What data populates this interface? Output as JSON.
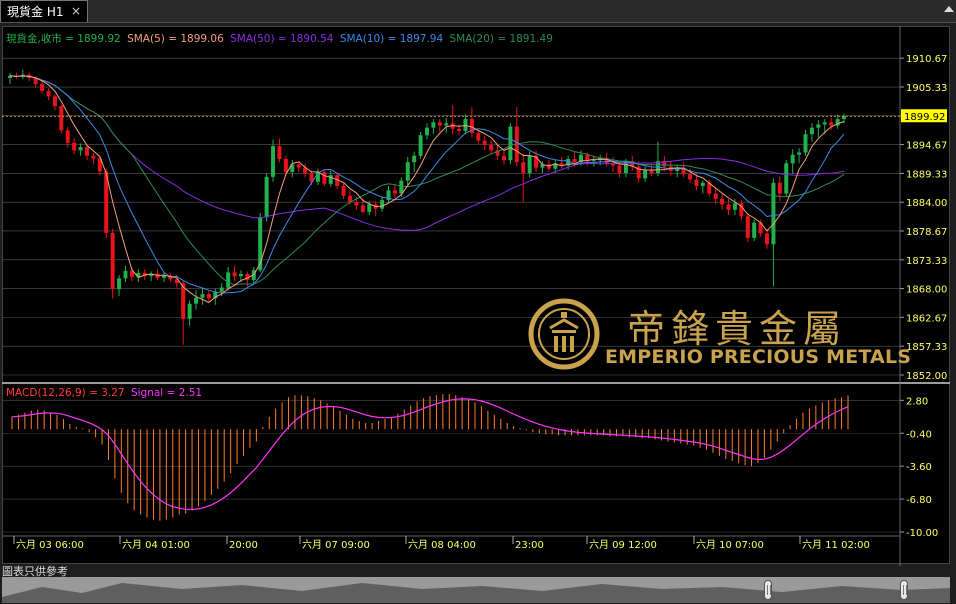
{
  "tab": {
    "title": "現貨金 H1",
    "close": "×"
  },
  "legend_main": {
    "symbol": "現貨金,收市 = 1899.92",
    "sma5": "SMA(5) = 1899.06",
    "sma50": "SMA(50) = 1890.54",
    "sma10": "SMA(10) = 1897.94",
    "sma20": "SMA(20) = 1891.49"
  },
  "legend_macd": {
    "macd": "MACD(12,26,9) = 3.27",
    "signal": "Signal = 2.51"
  },
  "current_price": "1899.92",
  "price_axis": [
    "1910.67",
    "1905.33",
    "1900.00",
    "1894.67",
    "1889.33",
    "1884.00",
    "1878.67",
    "1873.33",
    "1868.00",
    "1862.67",
    "1857.33",
    "1852.00"
  ],
  "macd_axis": [
    "2.80",
    "-0.40",
    "-3.60",
    "-6.80",
    "-10.00"
  ],
  "time_axis": [
    "六月 03 06:00",
    "六月 04 01:00",
    "20:00",
    "六月 07 09:00",
    "六月 08 04:00",
    "23:00",
    "六月 09 12:00",
    "六月 10 07:00",
    "六月 11 02:00"
  ],
  "logo": {
    "chinese": "帝鋒貴金屬",
    "english": "EMPERIO PRECIOUS METALS"
  },
  "footer_note": "圖表只供參考",
  "colors": {
    "bull": "#22b14c",
    "bear": "#e8141c",
    "sma5": "#f0a07a",
    "sma10": "#3d8ae8",
    "sma20": "#2e8b57",
    "sma50": "#8a2be2",
    "macd_hist": "#ff7f27",
    "signal": "#ff33ff",
    "axis_label": "#ffff66",
    "price_tag_bg": "#ffff00",
    "gold": "#c9a24e"
  },
  "chart_data": {
    "type": "candlestick",
    "price_range": [
      1852.0,
      1912.0
    ],
    "macd_range": [
      -10.0,
      4.0
    ],
    "candles": [
      [
        1907.0,
        1907.9,
        1905.9,
        1907.4
      ],
      [
        1907.4,
        1908.0,
        1906.9,
        1907.2
      ],
      [
        1907.2,
        1908.5,
        1906.8,
        1907.6
      ],
      [
        1907.6,
        1908.0,
        1906.4,
        1907.0
      ],
      [
        1907.0,
        1907.3,
        1905.2,
        1905.9
      ],
      [
        1905.9,
        1906.4,
        1904.1,
        1904.6
      ],
      [
        1904.6,
        1905.1,
        1902.9,
        1903.6
      ],
      [
        1903.6,
        1904.0,
        1901.0,
        1901.8
      ],
      [
        1901.8,
        1902.1,
        1896.7,
        1897.3
      ],
      [
        1897.3,
        1897.9,
        1894.1,
        1895.0
      ],
      [
        1895.0,
        1895.9,
        1892.9,
        1893.6
      ],
      [
        1893.6,
        1894.9,
        1892.6,
        1894.2
      ],
      [
        1894.2,
        1894.6,
        1891.8,
        1892.6
      ],
      [
        1892.6,
        1893.1,
        1891.0,
        1892.1
      ],
      [
        1892.1,
        1892.6,
        1889.0,
        1889.7
      ],
      [
        1889.7,
        1890.2,
        1877.4,
        1878.3
      ],
      [
        1878.3,
        1879.1,
        1866.2,
        1867.9
      ],
      [
        1867.9,
        1870.5,
        1866.6,
        1869.9
      ],
      [
        1869.9,
        1872.2,
        1869.2,
        1871.3
      ],
      [
        1871.3,
        1871.9,
        1869.4,
        1870.2
      ],
      [
        1870.2,
        1871.6,
        1869.2,
        1870.9
      ],
      [
        1870.9,
        1871.6,
        1869.6,
        1870.3
      ],
      [
        1870.3,
        1871.2,
        1869.4,
        1870.8
      ],
      [
        1870.8,
        1871.5,
        1869.6,
        1870.0
      ],
      [
        1870.0,
        1870.9,
        1869.2,
        1870.4
      ],
      [
        1870.4,
        1870.9,
        1869.2,
        1869.7
      ],
      [
        1869.7,
        1870.6,
        1868.2,
        1869.0
      ],
      [
        1869.0,
        1869.4,
        1857.6,
        1862.4
      ],
      [
        1862.4,
        1865.8,
        1861.1,
        1865.2
      ],
      [
        1865.2,
        1867.7,
        1864.1,
        1866.3
      ],
      [
        1866.3,
        1868.0,
        1865.0,
        1867.0
      ],
      [
        1867.0,
        1867.6,
        1865.6,
        1866.2
      ],
      [
        1866.2,
        1868.0,
        1865.0,
        1867.4
      ],
      [
        1867.4,
        1869.0,
        1866.6,
        1868.2
      ],
      [
        1868.2,
        1872.0,
        1867.6,
        1871.0
      ],
      [
        1871.0,
        1872.2,
        1869.4,
        1870.3
      ],
      [
        1870.3,
        1871.4,
        1869.2,
        1870.7
      ],
      [
        1870.7,
        1871.2,
        1868.4,
        1869.6
      ],
      [
        1869.6,
        1872.0,
        1869.0,
        1871.4
      ],
      [
        1871.4,
        1882.0,
        1871.0,
        1881.2
      ],
      [
        1881.2,
        1889.4,
        1880.4,
        1888.7
      ],
      [
        1888.7,
        1895.6,
        1887.8,
        1894.4
      ],
      [
        1894.4,
        1895.8,
        1891.4,
        1892.0
      ],
      [
        1892.0,
        1892.6,
        1888.8,
        1889.6
      ],
      [
        1889.6,
        1891.8,
        1888.6,
        1891.0
      ],
      [
        1891.0,
        1891.6,
        1889.6,
        1890.4
      ],
      [
        1890.4,
        1891.2,
        1888.6,
        1889.3
      ],
      [
        1889.3,
        1889.9,
        1887.2,
        1887.8
      ],
      [
        1887.8,
        1890.2,
        1887.2,
        1889.6
      ],
      [
        1889.6,
        1890.1,
        1887.0,
        1887.4
      ],
      [
        1887.4,
        1889.8,
        1886.8,
        1889.0
      ],
      [
        1889.0,
        1889.5,
        1886.4,
        1887.0
      ],
      [
        1887.0,
        1887.8,
        1884.6,
        1885.2
      ],
      [
        1885.2,
        1886.2,
        1883.6,
        1884.0
      ],
      [
        1884.0,
        1885.0,
        1882.6,
        1883.4
      ],
      [
        1883.4,
        1884.6,
        1881.8,
        1882.2
      ],
      [
        1882.2,
        1884.2,
        1881.6,
        1883.6
      ],
      [
        1883.6,
        1884.2,
        1881.4,
        1882.8
      ],
      [
        1882.8,
        1885.0,
        1882.2,
        1884.4
      ],
      [
        1884.4,
        1887.0,
        1883.8,
        1886.2
      ],
      [
        1886.2,
        1887.4,
        1884.8,
        1885.6
      ],
      [
        1885.6,
        1888.6,
        1885.0,
        1888.0
      ],
      [
        1888.0,
        1892.4,
        1887.2,
        1891.4
      ],
      [
        1891.4,
        1893.4,
        1889.6,
        1892.6
      ],
      [
        1892.6,
        1897.0,
        1892.0,
        1896.4
      ],
      [
        1896.4,
        1898.6,
        1895.6,
        1897.8
      ],
      [
        1897.8,
        1899.4,
        1896.6,
        1898.8
      ],
      [
        1898.8,
        1899.4,
        1897.0,
        1898.2
      ],
      [
        1898.2,
        1899.6,
        1896.8,
        1898.6
      ],
      [
        1898.6,
        1902.0,
        1896.6,
        1897.6
      ],
      [
        1897.6,
        1898.4,
        1896.4,
        1897.2
      ],
      [
        1897.2,
        1900.2,
        1896.6,
        1899.4
      ],
      [
        1899.4,
        1901.6,
        1896.0,
        1896.8
      ],
      [
        1896.8,
        1897.4,
        1894.8,
        1895.4
      ],
      [
        1895.4,
        1896.2,
        1893.6,
        1894.6
      ],
      [
        1894.6,
        1895.4,
        1893.0,
        1893.6
      ],
      [
        1893.6,
        1894.6,
        1891.8,
        1892.6
      ],
      [
        1892.6,
        1893.8,
        1891.0,
        1891.8
      ],
      [
        1891.8,
        1898.6,
        1891.0,
        1898.0
      ],
      [
        1898.0,
        1901.6,
        1890.6,
        1891.4
      ],
      [
        1891.4,
        1893.0,
        1884.0,
        1889.4
      ],
      [
        1889.4,
        1893.4,
        1888.6,
        1892.6
      ],
      [
        1892.6,
        1893.6,
        1889.6,
        1890.4
      ],
      [
        1890.4,
        1891.6,
        1889.4,
        1891.0
      ],
      [
        1891.0,
        1891.8,
        1889.6,
        1890.2
      ],
      [
        1890.2,
        1891.8,
        1889.4,
        1891.2
      ],
      [
        1891.2,
        1892.4,
        1890.2,
        1890.8
      ],
      [
        1890.8,
        1892.6,
        1890.0,
        1892.0
      ],
      [
        1892.0,
        1893.4,
        1890.6,
        1891.4
      ],
      [
        1891.4,
        1893.6,
        1890.8,
        1892.8
      ],
      [
        1892.8,
        1893.2,
        1890.8,
        1891.6
      ],
      [
        1891.6,
        1892.6,
        1890.6,
        1891.8
      ],
      [
        1891.8,
        1892.8,
        1890.8,
        1892.2
      ],
      [
        1892.2,
        1893.2,
        1890.6,
        1891.2
      ],
      [
        1891.2,
        1892.4,
        1889.6,
        1890.8
      ],
      [
        1890.8,
        1891.6,
        1888.6,
        1889.4
      ],
      [
        1889.4,
        1892.0,
        1888.6,
        1891.4
      ],
      [
        1891.4,
        1892.6,
        1889.8,
        1890.6
      ],
      [
        1890.6,
        1891.6,
        1887.6,
        1888.4
      ],
      [
        1888.4,
        1890.6,
        1887.8,
        1890.0
      ],
      [
        1890.0,
        1891.0,
        1888.8,
        1889.4
      ],
      [
        1889.4,
        1895.2,
        1888.8,
        1891.6
      ],
      [
        1891.6,
        1892.6,
        1889.8,
        1890.6
      ],
      [
        1890.6,
        1891.6,
        1888.8,
        1889.8
      ],
      [
        1889.8,
        1890.8,
        1888.6,
        1890.4
      ],
      [
        1890.4,
        1891.4,
        1888.6,
        1889.2
      ],
      [
        1889.2,
        1890.2,
        1887.6,
        1888.2
      ],
      [
        1888.2,
        1889.2,
        1886.2,
        1887.0
      ],
      [
        1887.0,
        1888.0,
        1885.6,
        1887.6
      ],
      [
        1887.6,
        1888.2,
        1885.0,
        1885.6
      ],
      [
        1885.6,
        1886.6,
        1883.6,
        1884.6
      ],
      [
        1884.6,
        1885.6,
        1882.6,
        1883.6
      ],
      [
        1883.6,
        1884.6,
        1881.6,
        1882.6
      ],
      [
        1882.6,
        1884.6,
        1881.6,
        1883.8
      ],
      [
        1883.8,
        1884.4,
        1880.6,
        1881.4
      ],
      [
        1881.4,
        1882.0,
        1876.6,
        1877.4
      ],
      [
        1877.4,
        1880.8,
        1876.8,
        1880.2
      ],
      [
        1880.2,
        1880.8,
        1877.6,
        1878.2
      ],
      [
        1878.2,
        1879.0,
        1875.4,
        1876.2
      ],
      [
        1876.2,
        1888.4,
        1868.4,
        1887.6
      ],
      [
        1887.6,
        1888.8,
        1884.2,
        1885.6
      ],
      [
        1885.6,
        1891.8,
        1885.0,
        1891.2
      ],
      [
        1891.2,
        1893.8,
        1889.2,
        1892.8
      ],
      [
        1892.8,
        1894.0,
        1891.2,
        1893.2
      ],
      [
        1893.2,
        1897.4,
        1892.6,
        1896.6
      ],
      [
        1896.6,
        1898.6,
        1895.2,
        1897.8
      ],
      [
        1897.8,
        1899.2,
        1896.0,
        1898.4
      ],
      [
        1898.4,
        1899.4,
        1896.6,
        1898.8
      ],
      [
        1898.8,
        1899.6,
        1897.4,
        1898.2
      ],
      [
        1898.2,
        1900.2,
        1897.6,
        1899.4
      ],
      [
        1899.4,
        1900.4,
        1898.6,
        1899.92
      ]
    ],
    "macd_hist": [
      1.2,
      1.4,
      1.6,
      1.8,
      1.9,
      1.8,
      1.6,
      1.4,
      1.0,
      0.5,
      0.2,
      0.1,
      -0.3,
      -0.8,
      -1.5,
      -3.0,
      -4.8,
      -6.2,
      -7.2,
      -7.9,
      -8.3,
      -8.6,
      -8.8,
      -8.9,
      -8.8,
      -8.6,
      -8.3,
      -8.2,
      -7.9,
      -7.5,
      -7.0,
      -6.4,
      -5.8,
      -5.1,
      -4.3,
      -3.4,
      -2.6,
      -1.8,
      -1.2,
      0.2,
      1.2,
      2.0,
      2.6,
      3.1,
      3.3,
      3.3,
      3.2,
      3.0,
      2.8,
      2.5,
      2.2,
      1.8,
      1.4,
      1.0,
      0.8,
      0.6,
      0.6,
      0.8,
      1.0,
      1.2,
      1.5,
      1.9,
      2.3,
      2.7,
      3.0,
      3.2,
      3.3,
      3.4,
      3.4,
      3.3,
      3.1,
      2.9,
      2.6,
      2.2,
      1.8,
      1.4,
      1.0,
      0.6,
      0.3,
      0.1,
      -0.1,
      -0.3,
      -0.4,
      -0.5,
      -0.5,
      -0.6,
      -0.6,
      -0.6,
      -0.6,
      -0.6,
      -0.6,
      -0.6,
      -0.6,
      -0.7,
      -0.7,
      -0.7,
      -0.8,
      -0.8,
      -0.9,
      -0.9,
      -1.0,
      -1.1,
      -1.2,
      -1.3,
      -1.4,
      -1.5,
      -1.6,
      -1.8,
      -2.0,
      -2.3,
      -2.6,
      -2.9,
      -3.1,
      -3.3,
      -3.5,
      -3.6,
      -3.3,
      -2.8,
      -2.0,
      -1.2,
      -0.4,
      0.4,
      1.0,
      1.6,
      2.0,
      2.3,
      2.6,
      2.8,
      3.0,
      3.1,
      3.27
    ]
  }
}
